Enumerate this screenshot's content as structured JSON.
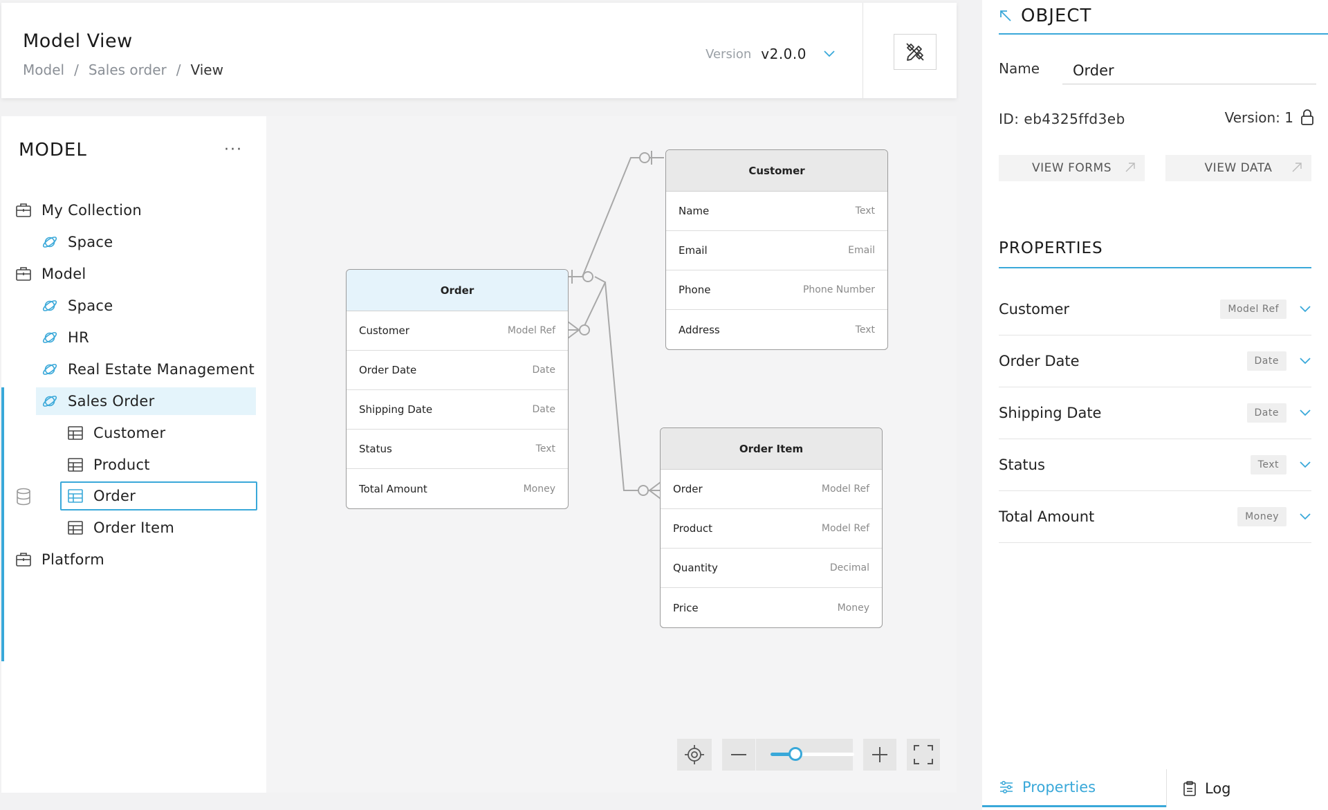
{
  "header": {
    "title": "Model View",
    "breadcrumb": [
      "Model",
      "/",
      "Sales order",
      "/",
      "View"
    ],
    "version_label": "Version",
    "version_value": "v2.0.0"
  },
  "sidebar": {
    "title": "MODEL",
    "more": "···",
    "items": [
      {
        "label": "My Collection",
        "icon": "briefcase-icon"
      },
      {
        "label": "Space",
        "icon": "planet-icon"
      },
      {
        "label": "Model",
        "icon": "briefcase-icon"
      },
      {
        "label": "Space",
        "icon": "planet-icon"
      },
      {
        "label": "HR",
        "icon": "planet-icon"
      },
      {
        "label": "Real Estate Management",
        "icon": "planet-icon"
      },
      {
        "label": "Sales Order",
        "icon": "planet-icon"
      },
      {
        "label": "Customer",
        "icon": "table-icon"
      },
      {
        "label": "Product",
        "icon": "table-icon"
      },
      {
        "label": "Order",
        "icon": "table-icon"
      },
      {
        "label": "Order Item",
        "icon": "table-icon"
      },
      {
        "label": "Platform",
        "icon": "briefcase-icon"
      }
    ]
  },
  "diagram": {
    "order": {
      "title": "Order",
      "fields": [
        {
          "name": "Customer",
          "type": "Model Ref"
        },
        {
          "name": "Order Date",
          "type": "Date"
        },
        {
          "name": "Shipping Date",
          "type": "Date"
        },
        {
          "name": "Status",
          "type": "Text"
        },
        {
          "name": "Total Amount",
          "type": "Money"
        }
      ]
    },
    "customer": {
      "title": "Customer",
      "fields": [
        {
          "name": "Name",
          "type": "Text"
        },
        {
          "name": "Email",
          "type": "Email"
        },
        {
          "name": "Phone",
          "type": "Phone Number"
        },
        {
          "name": "Address",
          "type": "Text"
        }
      ]
    },
    "order_item": {
      "title": "Order Item",
      "fields": [
        {
          "name": "Order",
          "type": "Model Ref"
        },
        {
          "name": "Product",
          "type": "Model Ref"
        },
        {
          "name": "Quantity",
          "type": "Decimal"
        },
        {
          "name": "Price",
          "type": "Money"
        }
      ]
    },
    "zoom_level": 0.3
  },
  "object_panel": {
    "title": "OBJECT",
    "name_label": "Name",
    "name_value": "Order",
    "id_text": "ID:  eb4325ffd3eb",
    "version_text": "Version:  1",
    "view_forms": "VIEW FORMS",
    "view_data": "VIEW DATA",
    "properties_title": "PROPERTIES",
    "properties": [
      {
        "name": "Customer",
        "type": "Model Ref"
      },
      {
        "name": "Order Date",
        "type": "Date"
      },
      {
        "name": "Shipping Date",
        "type": "Date"
      },
      {
        "name": "Status",
        "type": "Text"
      },
      {
        "name": "Total Amount",
        "type": "Money"
      }
    ],
    "tabs": [
      {
        "label": "Properties",
        "active": true
      },
      {
        "label": "Log",
        "active": false
      }
    ]
  },
  "colors": {
    "accent": "#39a8d9",
    "selected_row_bg": "#e4f4fb",
    "entity_header_highlight": "#e5f3fb"
  }
}
